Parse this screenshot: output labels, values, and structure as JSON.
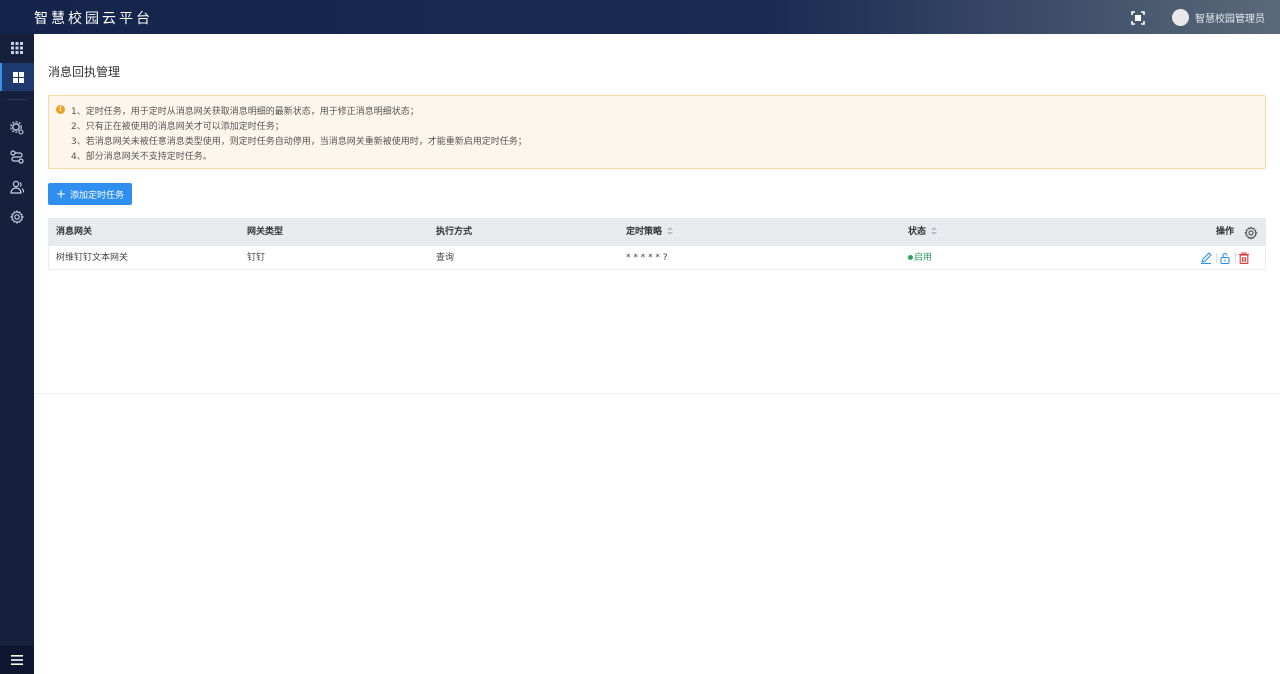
{
  "header": {
    "app_title": "智慧校园云平台",
    "user_name": "智慧校园管理员"
  },
  "sidebar": {
    "items": [
      {
        "icon": "apps-grid-icon"
      },
      {
        "icon": "dashboard-icon",
        "active": true
      },
      {
        "icon": "gear-users-icon"
      },
      {
        "icon": "flow-icon"
      },
      {
        "icon": "users-icon"
      },
      {
        "icon": "settings-icon"
      }
    ],
    "bottom_icon": "menu-toggle-icon"
  },
  "page": {
    "title": "消息回执管理",
    "notice_lines": [
      "1、定时任务，用于定时从消息网关获取消息明细的最新状态，用于修正消息明细状态；",
      "2、只有正在被使用的消息网关才可以添加定时任务；",
      "3、若消息网关未被任意消息类型使用，则定时任务自动停用，当消息网关重新被使用时，才能重新启用定时任务；",
      "4、部分消息网关不支持定时任务。"
    ],
    "add_button_label": "添加定时任务"
  },
  "table": {
    "columns": [
      "消息网关",
      "网关类型",
      "执行方式",
      "定时策略",
      "状态",
      "操作"
    ],
    "rows": [
      {
        "gateway": "树维钉钉文本网关",
        "gateway_type": "钉钉",
        "exec_mode": "查询",
        "schedule": "* * * * * ?",
        "status": "启用"
      }
    ]
  },
  "colors": {
    "header_bg": "#15244a",
    "sidebar_bg": "#16203d",
    "primary": "#2f8ff0",
    "status_enabled": "#2ea35a",
    "notice_bg": "#fdf6ec",
    "delete": "#e53935"
  }
}
